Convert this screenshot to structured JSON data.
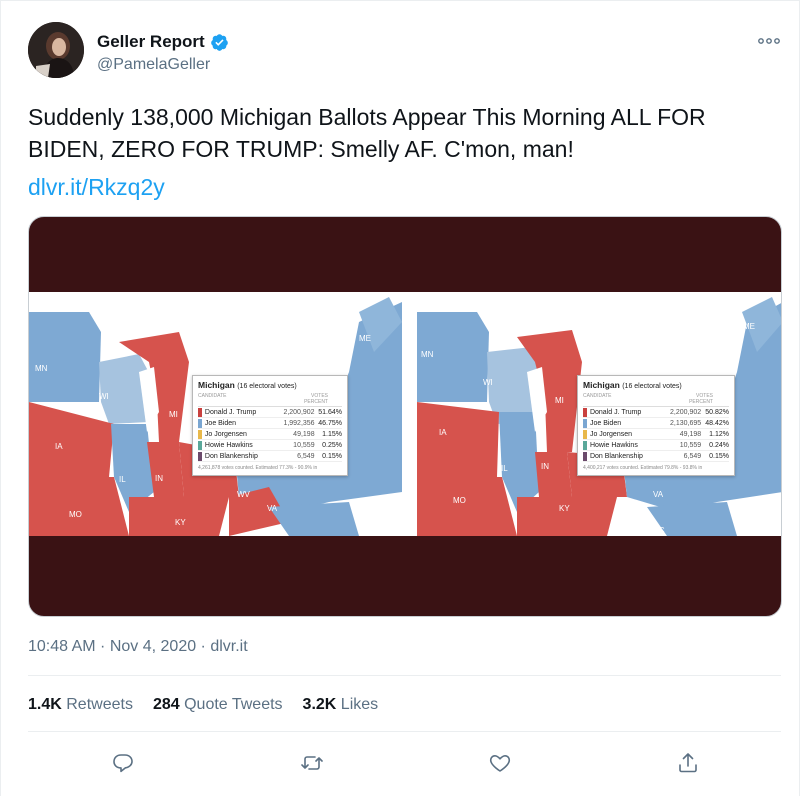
{
  "author": {
    "name": "Geller Report",
    "handle": "@PamelaGeller",
    "verified": true
  },
  "tweet": {
    "text": "Suddenly 138,000 Michigan Ballots Appear This Morning ALL FOR BIDEN, ZERO FOR TRUMP: Smelly AF. C'mon, man!",
    "link": "dlvr.it/Rkzq2y"
  },
  "media": {
    "left_map": {
      "popup": {
        "title": "Michigan",
        "subtitle": "(16 electoral votes)",
        "header_candidate": "CANDIDATE",
        "header_votes": "VOTES PERCENT",
        "rows": [
          {
            "candidate": "Donald J. Trump",
            "votes": "2,200,902",
            "percent": "51.64%",
            "color": "#c9413f"
          },
          {
            "candidate": "Joe Biden",
            "votes": "1,992,356",
            "percent": "46.75%",
            "color": "#7aa6d2"
          },
          {
            "candidate": "Jo Jorgensen",
            "votes": "49,198",
            "percent": "1.15%",
            "color": "#e8b84a"
          },
          {
            "candidate": "Howie Hawkins",
            "votes": "10,559",
            "percent": "0.25%",
            "color": "#5aa89a"
          },
          {
            "candidate": "Don Blankenship",
            "votes": "6,549",
            "percent": "0.15%",
            "color": "#6b4a6b"
          }
        ],
        "footer": "4,261,878 votes counted. Estimated 77.3% - 90.9% in"
      },
      "labels": [
        "MN",
        "WI",
        "MI",
        "IA",
        "IL",
        "IN",
        "MO",
        "KY",
        "WV",
        "VA",
        "ME"
      ]
    },
    "right_map": {
      "popup": {
        "title": "Michigan",
        "subtitle": "(16 electoral votes)",
        "header_candidate": "CANDIDATE",
        "header_votes": "VOTES PERCENT",
        "rows": [
          {
            "candidate": "Donald J. Trump",
            "votes": "2,200,902",
            "percent": "50.82%",
            "color": "#c9413f"
          },
          {
            "candidate": "Joe Biden",
            "votes": "2,130,695",
            "percent": "48.42%",
            "color": "#7aa6d2"
          },
          {
            "candidate": "Jo Jorgensen",
            "votes": "49,198",
            "percent": "1.12%",
            "color": "#e8b84a"
          },
          {
            "candidate": "Howie Hawkins",
            "votes": "10,559",
            "percent": "0.24%",
            "color": "#5aa89a"
          },
          {
            "candidate": "Don Blankenship",
            "votes": "6,549",
            "percent": "0.15%",
            "color": "#6b4a6b"
          }
        ],
        "footer": "4,400,217 votes counted. Estimated 79.8% - 93.8% in"
      },
      "labels": [
        "MN",
        "WI",
        "MI",
        "IA",
        "IL",
        "IN",
        "MO",
        "KY",
        "VA",
        "ME",
        "NC"
      ]
    }
  },
  "meta": {
    "time": "10:48 AM",
    "date": "Nov 4, 2020",
    "source": "dlvr.it",
    "separator": " · "
  },
  "stats": {
    "retweets_count": "1.4K",
    "retweets_label": "Retweets",
    "quotes_count": "284",
    "quotes_label": "Quote Tweets",
    "likes_count": "3.2K",
    "likes_label": "Likes"
  },
  "colors": {
    "link": "#1da1f2",
    "secondary": "#5b7083",
    "republican": "#d6534d",
    "democrat": "#7ea9d3",
    "media_bg": "#3a1214"
  },
  "icons": [
    "verified-badge-icon",
    "more-icon",
    "reply-icon",
    "retweet-icon",
    "like-icon",
    "share-icon"
  ]
}
